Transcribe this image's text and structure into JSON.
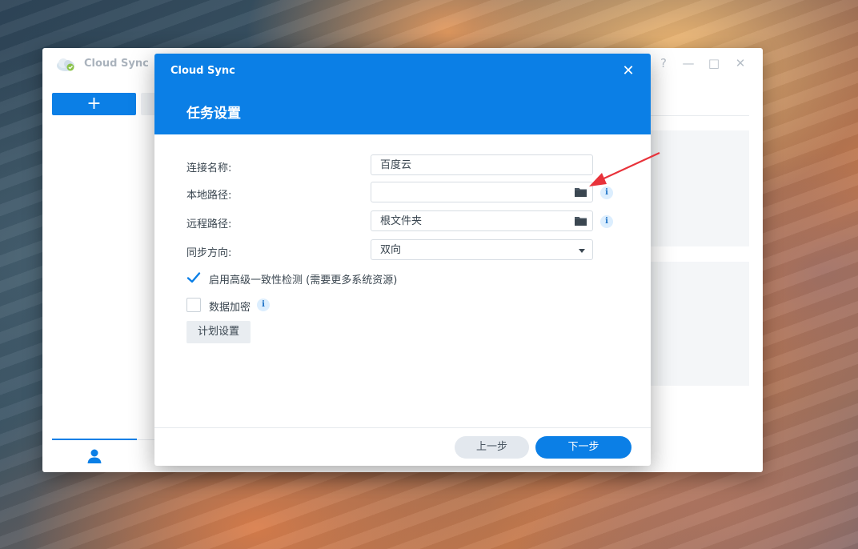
{
  "app": {
    "title": "Cloud Sync",
    "add_label": "+",
    "window_controls": [
      "?",
      "—",
      "□",
      "✕"
    ]
  },
  "dialog": {
    "app_title": "Cloud Sync",
    "close_label": "✕",
    "heading": "任务设置",
    "fields": {
      "connection_name": {
        "label": "连接名称:",
        "value": "百度云"
      },
      "local_path": {
        "label": "本地路径:",
        "value": ""
      },
      "remote_path": {
        "label": "远程路径:",
        "value": "根文件夹"
      },
      "sync_direction": {
        "label": "同步方向:",
        "value": "双向"
      }
    },
    "advanced_check": {
      "label": "启用高级一致性检测 (需要更多系统资源)",
      "checked": true
    },
    "encryption": {
      "label": "数据加密",
      "checked": false
    },
    "schedule_button": "计划设置",
    "prev_button": "上一步",
    "next_button": "下一步",
    "info_glyph": "i"
  },
  "colors": {
    "accent": "#0b7fe6",
    "annotation_arrow": "#e8323a"
  },
  "icons": [
    "cloud-sync-logo-icon",
    "folder-icon",
    "info-icon",
    "checkmark-icon",
    "user-icon",
    "close-icon",
    "dropdown-caret-icon"
  ]
}
